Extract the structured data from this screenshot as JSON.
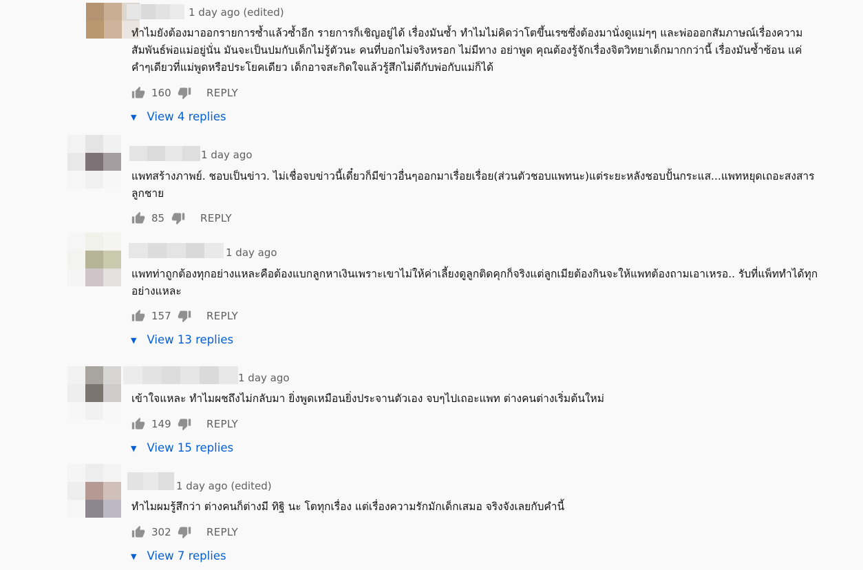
{
  "comments": [
    {
      "time": "1 day ago (edited)",
      "text": "ทำไมยังต้องมาออกรายการซ้ำแล้วซ้ำอีก รายการก็เชิญอยู่ได้ เรื่องมันซ้ำ ทำไมไม่คิดว่าโตขึ้นเรซซึ่งต้องมานั่งดูแม่ๆๆ และพ่อออกสัมภาษณ์เรื่องความสัมพันธ์พ่อแม่อยู่นั่น มันจะเป็นปมกับเด็กไม่รู้ตัวนะ คนที่บอกไม่จริงหรอก ไม่มีทาง อย่าพูด คุณต้องรู้จักเรื่องจิตวิทยาเด็กมากกว่านี้ เรื่องมันซ้ำซ้อน แค่คำๆเดียวที่แม่พูดหรือประโยคเดียว เด็กอาจสะกิดใจแล้วรู้สึกไม่ดีกับพ่อกับแม่ก็ได้",
      "likes": "160",
      "reply_label": "REPLY",
      "view_replies": "View 4 replies"
    },
    {
      "time": "1 day ago",
      "text": "แพทสร้างภาพย์. ชอบเป็นข่าว.  ไม่เชื่อจบข่าวนี้เดี๋ยวก็มีข่าวอื่นๆออกมาเรื่อยเรื่อย(ส่วนตัวชอบแพทนะ)แต่ระยะหลังชอบปั้นกระแส...แพทหยุดเถอะสงสารลูกชาย",
      "likes": "85",
      "reply_label": "REPLY",
      "view_replies": ""
    },
    {
      "time": "1 day ago",
      "text": "แพทท่าถูกต้องทุกอย่างแหละคือต้องแบกลูกหาเงินเพราะเขาไม่ให้ค่าเลี้ยงดูลูกติดคุกก็จริงแต่ลูกเมียต้องกินจะให้แพทต้องถามเอาเหรอ.. รับที่แพ็ททำได้ทุกอย่างแหละ",
      "likes": "157",
      "reply_label": "REPLY",
      "view_replies": "View 13 replies"
    },
    {
      "time": "1 day ago",
      "text": "เข้าใจแหละ ทำไมผชถึงไม่กลับมา ยิ่งพูดเหมือนยิ่งประจานตัวเอง จบๆไปเถอะแพท ต่างคนต่างเริ่มต้นใหม่",
      "likes": "149",
      "reply_label": "REPLY",
      "view_replies": "View 15 replies"
    },
    {
      "time": "1 day ago (edited)",
      "text": "ทำไมผมรู้สึกว่า ต่างคนก็ต่างมี ทิฐิ นะ โตทุกเรื่อง แต่เรื่องความรักมักเด็กเสมอ จริงจังเลยกับคำนี้",
      "likes": "302",
      "reply_label": "REPLY",
      "view_replies": "View 7 replies"
    }
  ],
  "icons": {
    "like": "thumbs-up-icon",
    "dislike": "thumbs-down-icon",
    "expand": "caret-down-icon"
  },
  "colors": {
    "link": "#065fd4",
    "secondary_text": "#606060",
    "icon": "#909090",
    "background": "#f9f9f9"
  }
}
